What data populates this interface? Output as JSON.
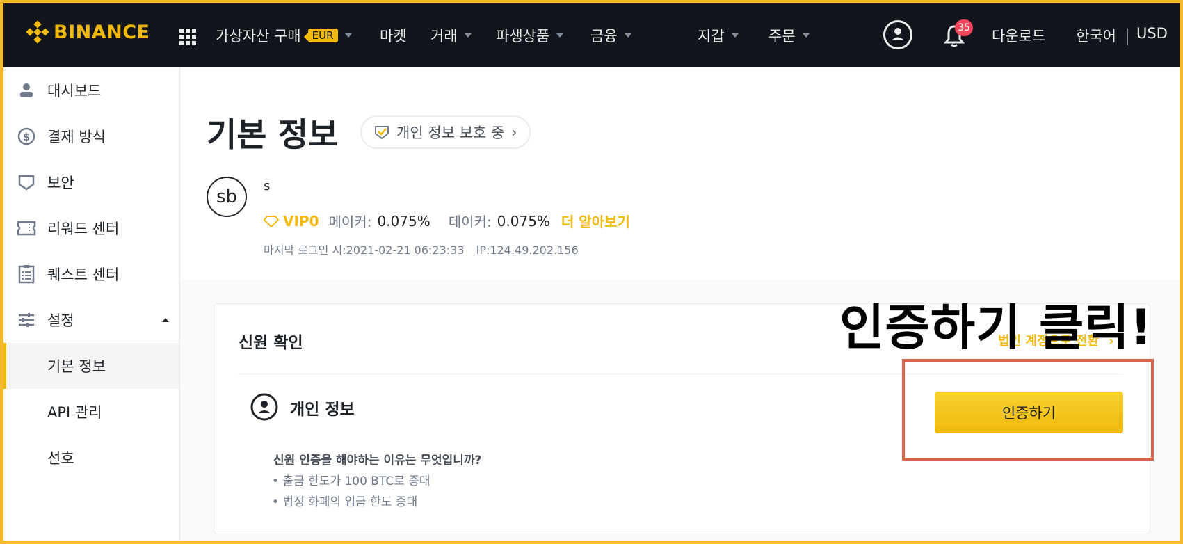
{
  "header": {
    "logo_text": "BINANCE",
    "nav": [
      {
        "label": "가상자산 구매",
        "badge": "EUR"
      },
      {
        "label": "마켓"
      },
      {
        "label": "거래"
      },
      {
        "label": "파생상품"
      },
      {
        "label": "금융"
      }
    ],
    "right_nav": {
      "wallet": "지갑",
      "orders": "주문",
      "notification_count": "35",
      "download": "다운로드",
      "language": "한국어",
      "currency": "USD"
    }
  },
  "sidebar": {
    "items": [
      {
        "label": "대시보드",
        "icon": "user-icon"
      },
      {
        "label": "결제 방식",
        "icon": "dollar-circle-icon"
      },
      {
        "label": "보안",
        "icon": "shield-icon"
      },
      {
        "label": "리워드 센터",
        "icon": "ticket-icon"
      },
      {
        "label": "퀘스트 센터",
        "icon": "clipboard-icon"
      },
      {
        "label": "설정",
        "icon": "sliders-icon"
      },
      {
        "label": "기본 정보",
        "active": true
      },
      {
        "label": "API 관리"
      },
      {
        "label": "선호"
      }
    ]
  },
  "profile": {
    "page_title": "기본 정보",
    "privacy_label": "개인 정보 보호 중",
    "avatar_initials": "sb",
    "username": "s",
    "vip_label": "VIP0",
    "maker_label": "메이커:",
    "maker_fee": "0.075%",
    "taker_label": "테이커:",
    "taker_fee": "0.075%",
    "learn_more": "더 알아보기",
    "last_login_label": "마지막 로그인 시:",
    "last_login_time": "2021-02-21 06:23:33",
    "ip_label": "IP:",
    "ip": "124.49.202.156"
  },
  "identity": {
    "title": "신원 확인",
    "switch_link": "법인 계정으로 전환",
    "section_title": "개인 정보",
    "why_title": "신원 인증을 해야하는 이유는 무엇입니까?",
    "bullets": [
      "• 출금 한도가 100 BTC로 증대",
      "• 법정 화폐의 입금 한도 증대"
    ],
    "verify_button": "인증하기"
  },
  "annotation": {
    "text": "인증하기 클릭!",
    "color": "#d9624a"
  },
  "colors": {
    "brand": "#f0b90b",
    "topbar_bg": "#12161c",
    "badge_red": "#f6465d"
  }
}
